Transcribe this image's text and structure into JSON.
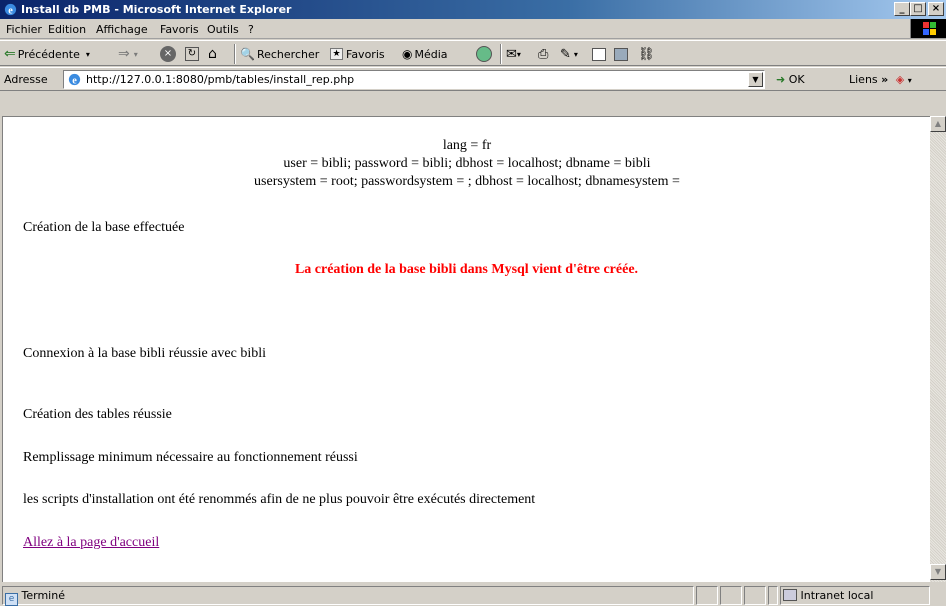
{
  "window": {
    "title": "Install db PMB - Microsoft Internet Explorer",
    "buttons": {
      "minimize": "_",
      "maximize": "□",
      "close": "×"
    }
  },
  "menu": {
    "items": [
      "Fichier",
      "Edition",
      "Affichage",
      "Favoris",
      "Outils",
      "?"
    ]
  },
  "toolbar": {
    "back": "Précédente",
    "search": "Rechercher",
    "favorites": "Favoris",
    "media": "Média"
  },
  "address": {
    "label": "Adresse",
    "url": "http://127.0.0.1:8080/pmb/tables/install_rep.php",
    "go": "OK",
    "links": "Liens"
  },
  "content": {
    "params": {
      "lang": "lang = fr",
      "user": "user = bibli; password = bibli; dbhost = localhost; dbname = bibli",
      "system": "usersystem = root; passwordsystem = ; dbhost = localhost; dbnamesystem ="
    },
    "creation_done": "Création de la base effectuée",
    "creation_success": "La création de la base bibli dans Mysql vient d'être créée.",
    "connection": "Connexion à la base bibli réussie avec bibli",
    "tables": "Création des tables réussie",
    "fill": "Remplissage minimum nécessaire au fonctionnement réussi",
    "scripts": "les scripts d'installation ont été renommés afin de ne plus pouvoir être exécutés directement",
    "home_link": "Allez à la page d'accueil"
  },
  "status": {
    "text": "Terminé",
    "zone": "Intranet local"
  },
  "colors": {
    "titlebar": "#0a246a",
    "error_red": "#ff0000",
    "visited_link": "#800080"
  },
  "icons": [
    "ie-icon",
    "back-arrow-icon",
    "forward-arrow-icon",
    "stop-icon",
    "refresh-icon",
    "home-icon",
    "search-icon",
    "favorites-icon",
    "media-icon",
    "history-icon",
    "mail-icon",
    "print-icon",
    "edit-icon",
    "discuss-icon",
    "messenger-icon",
    "windows-logo-icon",
    "intranet-icon"
  ]
}
